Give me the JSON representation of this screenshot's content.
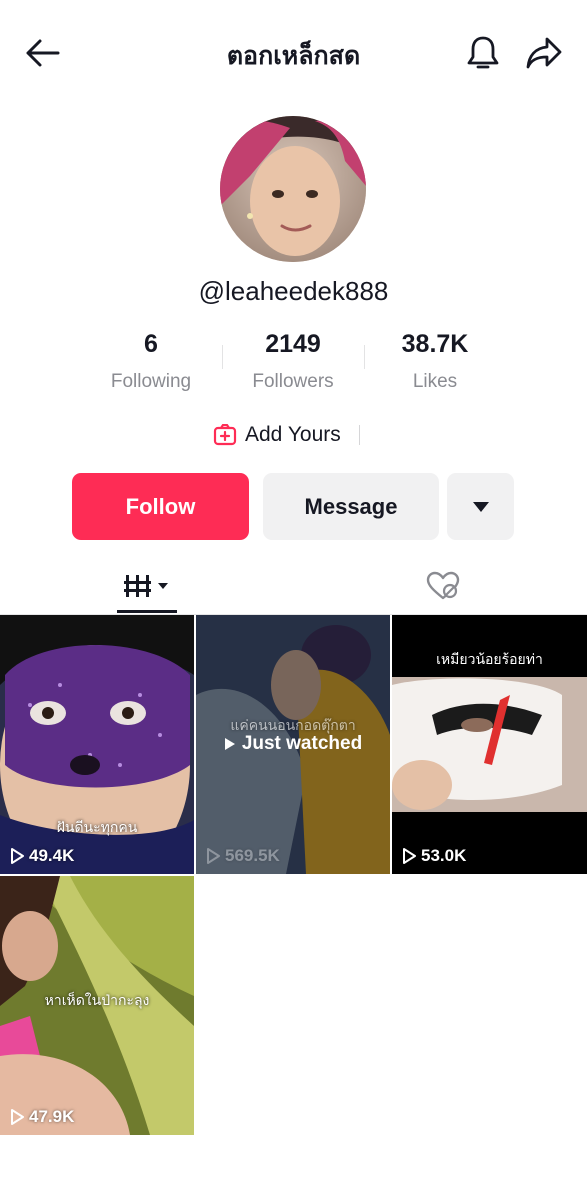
{
  "header": {
    "title": "ตอกเหล็กสด",
    "back_icon": "arrow-left-icon",
    "bell_icon": "bell-icon",
    "share_icon": "share-arrow-icon"
  },
  "profile": {
    "username": "@leaheedek888",
    "stats": [
      {
        "value": "6",
        "label": "Following"
      },
      {
        "value": "2149",
        "label": "Followers"
      },
      {
        "value": "38.7K",
        "label": "Likes"
      }
    ],
    "add_yours": "Add Yours"
  },
  "actions": {
    "follow": "Follow",
    "message": "Message"
  },
  "tabs": {
    "videos_icon": "grid-videos-icon",
    "liked_icon": "hidden-liked-icon"
  },
  "videos": [
    {
      "caption": "ฝันดีนะทุกคน",
      "views": "49.4K",
      "just_watched": ""
    },
    {
      "caption": "แค่คนนอนกอดตุ๊กตา",
      "views": "569.5K",
      "just_watched": "Just watched"
    },
    {
      "caption": "เหมียวน้อยร้อยท่า",
      "views": "53.0K",
      "just_watched": ""
    },
    {
      "caption": "หาเห็ดในป่ากะลุง",
      "views": "47.9K",
      "just_watched": ""
    }
  ],
  "colors": {
    "accent": "#fe2c55",
    "button_gray": "#f1f1f2",
    "muted_text": "#8a8b91"
  }
}
